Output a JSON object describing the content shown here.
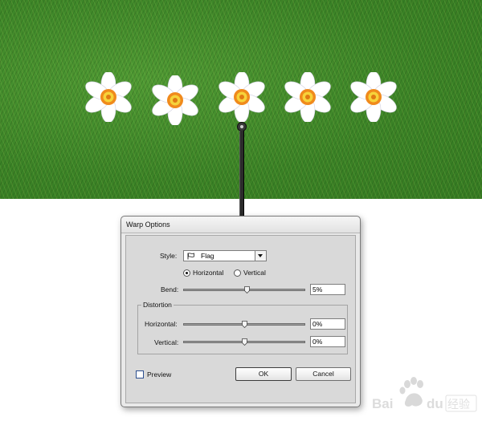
{
  "dialog": {
    "title": "Warp Options",
    "style_label": "Style:",
    "style_value": "Flag",
    "orientation": {
      "horizontal_label": "Horizontal",
      "vertical_label": "Vertical",
      "selected": "Horizontal"
    },
    "bend": {
      "label": "Bend:",
      "value": "5%",
      "slider_fraction": 0.525
    },
    "distortion": {
      "group_label": "Distortion",
      "horizontal": {
        "label": "Horizontal:",
        "value": "0%",
        "slider_fraction": 0.5
      },
      "vertical": {
        "label": "Vertical:",
        "value": "0%",
        "slider_fraction": 0.5
      }
    },
    "preview_label": "Preview",
    "preview_checked": false,
    "ok_label": "OK",
    "cancel_label": "Cancel"
  },
  "canvas": {
    "flower_count": 5,
    "colors": {
      "grass": "#3f8a2a",
      "petal": "#ffffff",
      "corona_outer": "#f08a1c",
      "corona_inner": "#f6d23a",
      "handle": "#2b2b2b",
      "checkbox_border": "#2c4f8f"
    }
  },
  "icons": [
    "flag-icon",
    "dropdown-arrow-icon",
    "flower-icon",
    "warp-handle-icon",
    "baidu-paw-icon"
  ]
}
